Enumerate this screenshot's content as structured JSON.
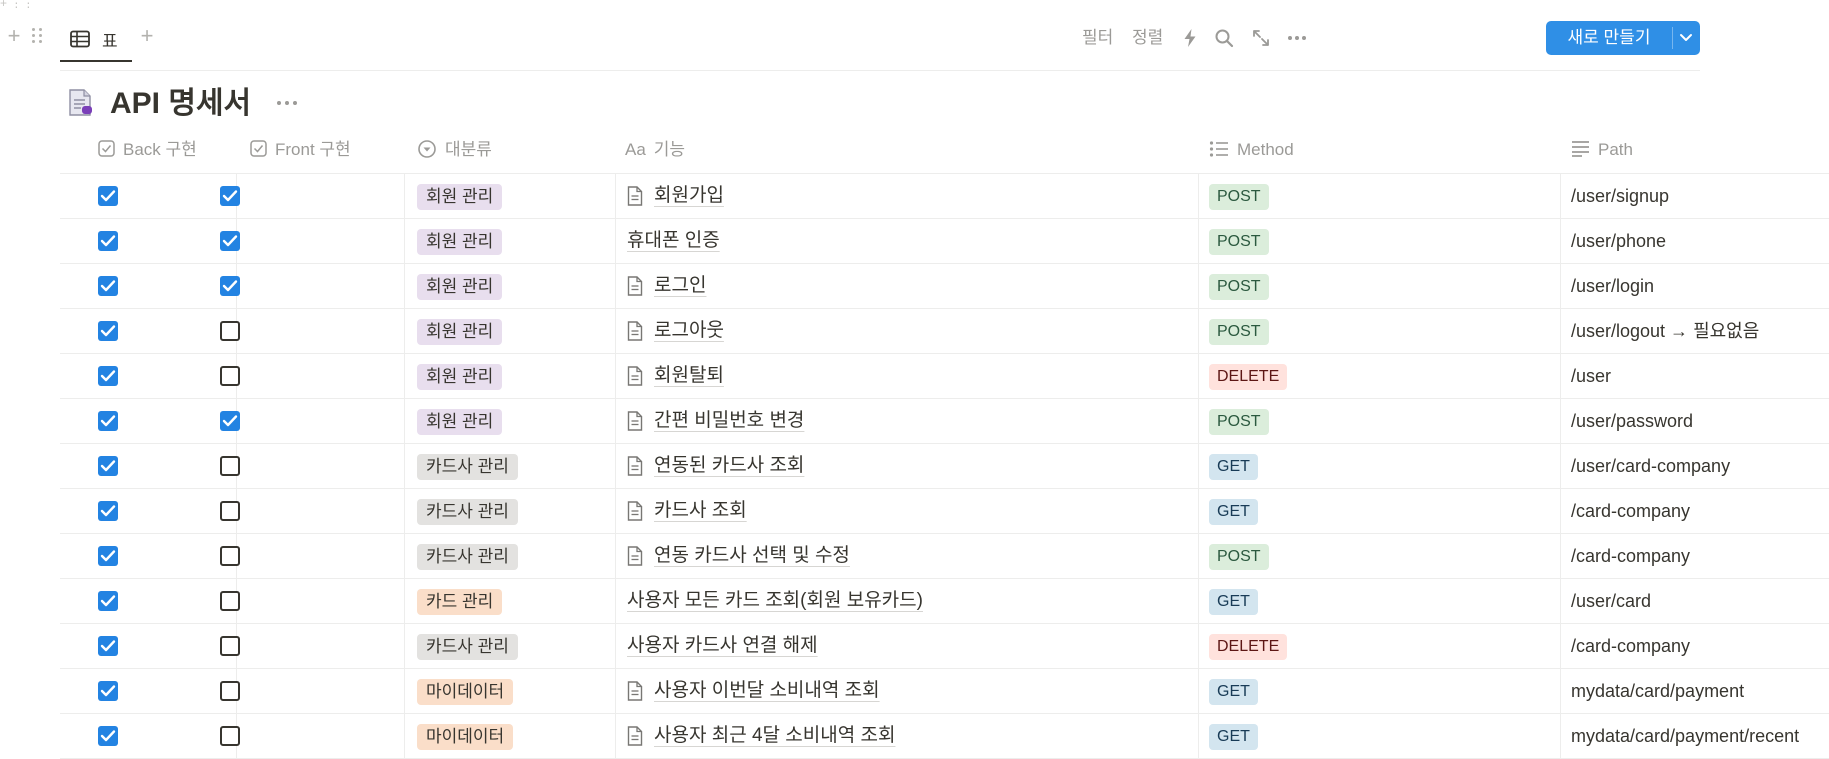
{
  "toolbar": {
    "view_tab_label": "표",
    "filter_label": "필터",
    "sort_label": "정렬",
    "new_button_label": "새로 만들기"
  },
  "database": {
    "title": "API 명세서"
  },
  "columns": {
    "back": "Back 구현",
    "front": "Front 구현",
    "category": "대분류",
    "feature": "기능",
    "method": "Method",
    "path": "Path"
  },
  "colors": {
    "checkbox_on": "#2383e2",
    "new_button": "#2f8fe6",
    "tag_member": "#e8deee",
    "tag_cardcompany": "#e3e2e0",
    "tag_card": "#fadec9",
    "tag_mydata": "#fadec9",
    "method_post": "#dbeddb",
    "method_get": "#d3e5ef",
    "method_delete": "#ffe2dd"
  },
  "rows": [
    {
      "back": true,
      "front": true,
      "category": "회원 관리",
      "cat_color": "member",
      "feature": "회원가입",
      "page_icon": true,
      "method": "POST",
      "path": "/user/signup"
    },
    {
      "back": true,
      "front": true,
      "category": "회원 관리",
      "cat_color": "member",
      "feature": "휴대폰 인증",
      "page_icon": false,
      "method": "POST",
      "path": "/user/phone"
    },
    {
      "back": true,
      "front": true,
      "category": "회원 관리",
      "cat_color": "member",
      "feature": "로그인",
      "page_icon": true,
      "method": "POST",
      "path": "/user/login"
    },
    {
      "back": true,
      "front": false,
      "category": "회원 관리",
      "cat_color": "member",
      "feature": "로그아웃",
      "page_icon": true,
      "method": "POST",
      "path": "/user/logout → 필요없음"
    },
    {
      "back": true,
      "front": false,
      "category": "회원 관리",
      "cat_color": "member",
      "feature": "회원탈퇴",
      "page_icon": true,
      "method": "DELETE",
      "path": "/user"
    },
    {
      "back": true,
      "front": true,
      "category": "회원 관리",
      "cat_color": "member",
      "feature": "간편 비밀번호 변경",
      "page_icon": true,
      "method": "POST",
      "path": "/user/password"
    },
    {
      "back": true,
      "front": false,
      "category": "카드사 관리",
      "cat_color": "cardcompany",
      "feature": "연동된 카드사 조회",
      "page_icon": true,
      "method": "GET",
      "path": "/user/card-company"
    },
    {
      "back": true,
      "front": false,
      "category": "카드사 관리",
      "cat_color": "cardcompany",
      "feature": "카드사 조회",
      "page_icon": true,
      "method": "GET",
      "path": "/card-company"
    },
    {
      "back": true,
      "front": false,
      "category": "카드사 관리",
      "cat_color": "cardcompany",
      "feature": "연동 카드사 선택 및 수정",
      "page_icon": true,
      "method": "POST",
      "path": "/card-company"
    },
    {
      "back": true,
      "front": false,
      "category": "카드 관리",
      "cat_color": "card",
      "feature": "사용자 모든 카드 조회(회원 보유카드)",
      "page_icon": false,
      "method": "GET",
      "path": "/user/card"
    },
    {
      "back": true,
      "front": false,
      "category": "카드사 관리",
      "cat_color": "cardcompany",
      "feature": "사용자 카드사 연결 해제",
      "page_icon": false,
      "method": "DELETE",
      "path": "/card-company"
    },
    {
      "back": true,
      "front": false,
      "category": "마이데이터",
      "cat_color": "mydata",
      "feature": "사용자 이번달 소비내역 조회",
      "page_icon": true,
      "method": "GET",
      "path": "mydata/card/payment"
    },
    {
      "back": true,
      "front": false,
      "category": "마이데이터",
      "cat_color": "mydata",
      "feature": "사용자 최근 4달 소비내역 조회",
      "page_icon": true,
      "method": "GET",
      "path": "mydata/card/payment/recent"
    }
  ]
}
